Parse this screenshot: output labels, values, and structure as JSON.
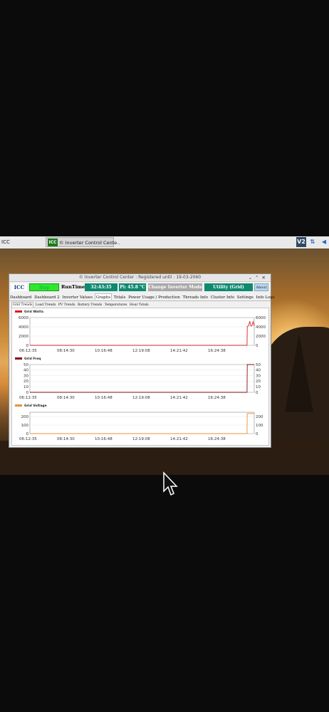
{
  "taskbar": {
    "left_label": "ICC",
    "task_label": "© Inverter Control Cente..",
    "task_logo": "ICC",
    "tray": {
      "vnc": "V2",
      "network_icon": "updown-arrows-icon",
      "volume_icon": "speaker-icon"
    }
  },
  "window": {
    "title": "© Inverter Control Center : Registered until : 19-03-2060",
    "toolbar": {
      "logo": "ICC",
      "stop": "Stop",
      "runtime_label": "RunTime",
      "runtime_value": "32:43:35",
      "pi_value": "Pi: 45.8 °C",
      "change_mode": "Change Inverter Mode",
      "utility": "Utility (Grid)",
      "about": "About"
    },
    "tabs": [
      "Dashboard",
      "Dashboard 2",
      "Inverter Values",
      "Graphs",
      "Totals",
      "Power Usage / Production",
      "Threads Info",
      "Cluster Info",
      "Settings",
      "Info Logs"
    ],
    "active_tab": "Graphs",
    "subtabs": [
      "Grid Trends",
      "Load Trends",
      "PV Trends",
      "Battery Trends",
      "Temperatures",
      "Hour Totals"
    ],
    "active_subtab": "Grid Trends"
  },
  "chart_data": [
    {
      "type": "line",
      "title": "Grid Watts",
      "x_ticks": [
        "06:12:35",
        "08:14:30",
        "10:16:48",
        "12:19:08",
        "14:21:42",
        "16:24:38"
      ],
      "y_ticks": [
        0,
        2000,
        4000,
        6000
      ],
      "ylim": [
        0,
        6000
      ],
      "series": [
        {
          "name": "Grid Watts",
          "color": "#d62020",
          "x": [
            0,
            0.1,
            0.2,
            0.3,
            0.4,
            0.5,
            0.6,
            0.7,
            0.8,
            0.9,
            0.968,
            0.969,
            0.975,
            0.98,
            0.985,
            0.99,
            0.995,
            1.0
          ],
          "values": [
            0,
            0,
            0,
            0,
            0,
            0,
            0,
            0,
            0,
            0,
            0,
            4100,
            4200,
            5200,
            4150,
            4300,
            5100,
            4200
          ]
        }
      ]
    },
    {
      "type": "line",
      "title": "Grid Freq",
      "x_ticks": [
        "06:12:35",
        "08:14:30",
        "10:16:48",
        "12:19:08",
        "14:21:42",
        "16:24:38"
      ],
      "y_ticks": [
        0,
        10,
        20,
        30,
        40,
        50
      ],
      "ylim": [
        0,
        50
      ],
      "series": [
        {
          "name": "Grid Freq",
          "color": "#8a0a0a",
          "x": [
            0,
            0.2,
            0.4,
            0.6,
            0.8,
            0.968,
            0.969,
            1.0
          ],
          "values": [
            0,
            0,
            0,
            0,
            0,
            0,
            50,
            50
          ]
        }
      ]
    },
    {
      "type": "line",
      "title": "Grid Voltage",
      "x_ticks": [
        "06:12:35",
        "08:14:30",
        "10:16:48",
        "12:19:08",
        "14:21:42",
        "16:24:38"
      ],
      "y_ticks": [
        0,
        100,
        200
      ],
      "ylim": [
        0,
        250
      ],
      "series": [
        {
          "name": "Grid Voltage",
          "color": "#e8903a",
          "x": [
            0,
            0.2,
            0.4,
            0.6,
            0.8,
            0.968,
            0.969,
            1.0
          ],
          "values": [
            0,
            0,
            0,
            0,
            0,
            0,
            235,
            235
          ]
        }
      ]
    }
  ]
}
